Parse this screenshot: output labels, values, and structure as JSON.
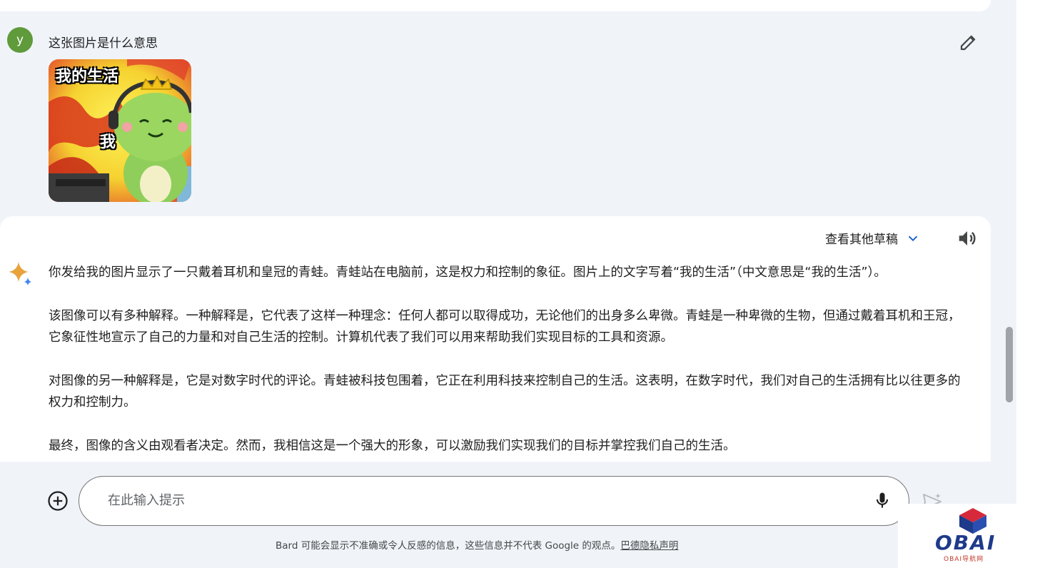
{
  "user": {
    "avatar_letter": "y",
    "message": "这张图片是什么意思",
    "image": {
      "caption_top": "我的生活",
      "caption_mid": "我"
    }
  },
  "response": {
    "drafts_label": "查看其他草稿",
    "paragraphs": [
      "你发给我的图片显示了一只戴着耳机和皇冠的青蛙。青蛙站在电脑前，这是权力和控制的象征。图片上的文字写着“我的生活”（中文意思是“我的生活”）。",
      "该图像可以有多种解释。一种解释是，它代表了这样一种理念：任何人都可以取得成功，无论他们的出身多么卑微。青蛙是一种卑微的生物，但通过戴着耳机和王冠，它象征性地宣示了自己的力量和对自己生活的控制。计算机代表了我们可以用来帮助我们实现目标的工具和资源。",
      "对图像的另一种解释是，它是对数字时代的评论。青蛙被科技包围着，它正在利用科技来控制自己的生活。这表明，在数字时代，我们对自己的生活拥有比以往更多的权力和控制力。",
      "最终，图像的含义由观看者决定。然而，我相信这是一个强大的形象，可以激励我们实现我们的目标并掌控我们自己的生活。"
    ]
  },
  "input": {
    "placeholder": "在此输入提示"
  },
  "footer": {
    "disclaimer": "Bard 可能会显示不准确或令人反感的信息，这些信息并不代表 Google 的观点。",
    "privacy_link": "巴德隐私声明"
  },
  "watermark": {
    "brand": "OBAI",
    "subtitle": "OBAI导航网"
  },
  "colors": {
    "background": "#f0f4f9",
    "card": "#ffffff",
    "avatar": "#5f9a3b",
    "spark_blue": "#4285f4",
    "spark_gold": "#e8a33d",
    "accent": "#0b57d0"
  },
  "icons": [
    "edit-icon",
    "chevron-down-icon",
    "volume-icon",
    "sparkle-icon",
    "add-circle-icon",
    "mic-icon",
    "send-icon"
  ]
}
